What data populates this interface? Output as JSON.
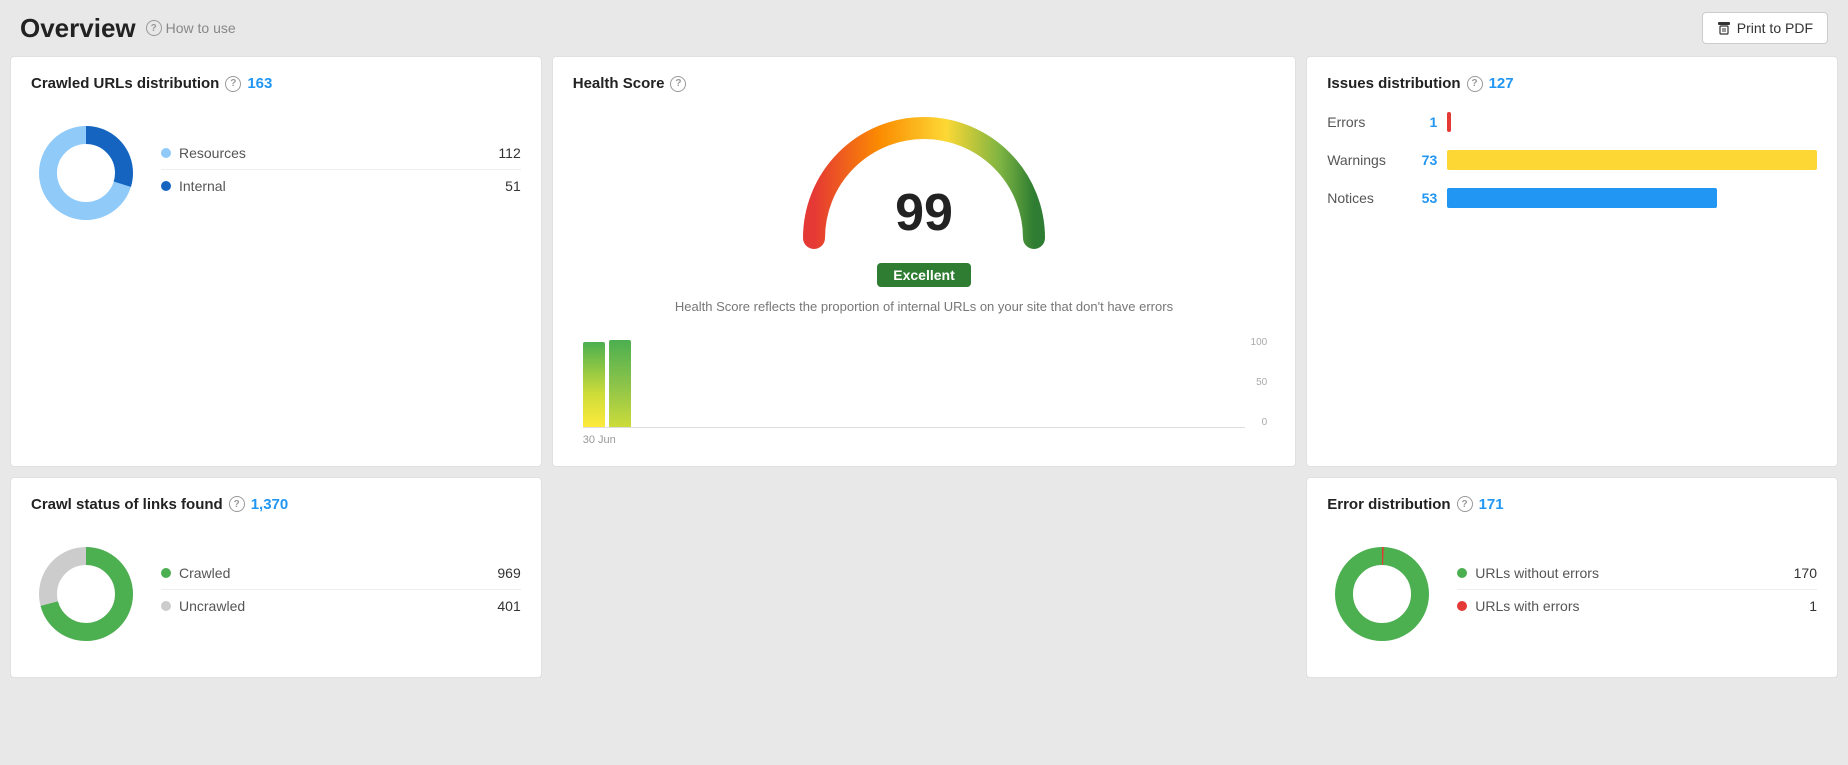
{
  "header": {
    "title": "Overview",
    "how_to_use": "How to use",
    "print_btn": "Print to PDF"
  },
  "crawled_urls": {
    "title": "Crawled URLs distribution",
    "count": "163",
    "resources_label": "Resources",
    "resources_value": "112",
    "internal_label": "Internal",
    "internal_value": "51"
  },
  "health_score": {
    "title": "Health Score",
    "score": "99",
    "badge": "Excellent",
    "description": "Health Score reflects the proportion of internal URLs on your site that don't have errors",
    "chart_date": "30 Jun",
    "y_100": "100",
    "y_50": "50",
    "y_0": "0"
  },
  "issues_dist": {
    "title": "Issues distribution",
    "count": "127",
    "errors_label": "Errors",
    "errors_value": "1",
    "warnings_label": "Warnings",
    "warnings_value": "73",
    "notices_label": "Notices",
    "notices_value": "53"
  },
  "crawl_status": {
    "title": "Crawl status of links found",
    "count": "1,370",
    "crawled_label": "Crawled",
    "crawled_value": "969",
    "uncrawled_label": "Uncrawled",
    "uncrawled_value": "401"
  },
  "error_dist": {
    "title": "Error distribution",
    "count": "171",
    "no_error_label": "URLs without errors",
    "no_error_value": "170",
    "with_error_label": "URLs with errors",
    "with_error_value": "1"
  }
}
